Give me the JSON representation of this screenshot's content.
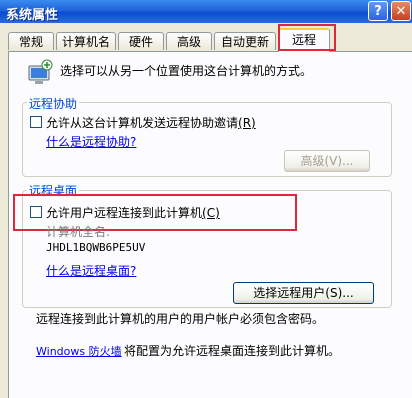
{
  "window": {
    "title": "系统属性",
    "help_glyph": "?",
    "close_glyph": "✕"
  },
  "tabs": [
    {
      "label": "常规"
    },
    {
      "label": "计算机名"
    },
    {
      "label": "硬件"
    },
    {
      "label": "高级"
    },
    {
      "label": "自动更新"
    },
    {
      "label": "远程"
    }
  ],
  "intro_text": "选择可以从另一个位置使用这台计算机的方式。",
  "remote_assistance": {
    "group_label": "远程协助",
    "checkbox_label": "允许从这台计算机发送远程协助邀请",
    "checkbox_accel": "(R)",
    "checked": false,
    "link": "什么是远程协助?",
    "advanced_button": "高级(V)..."
  },
  "remote_desktop": {
    "group_label": "远程桌面",
    "checkbox_label": "允许用户远程连接到此计算机",
    "checkbox_accel": "(C)",
    "checked": false,
    "full_name_label": "计算机全名:",
    "computer_name": "JHDL1BQWB6PE5UV",
    "link": "什么是远程桌面?",
    "select_users_button": "选择远程用户(S)...",
    "password_note": "远程连接到此计算机的用户的用户帐户必须包含密码。",
    "firewall_link": "Windows 防火墙",
    "firewall_text": "将配置为允许远程桌面连接到此计算机。"
  },
  "colors": {
    "group_label": "#0046d5",
    "highlight_box": "#e0263a",
    "link": "#0000ee"
  }
}
